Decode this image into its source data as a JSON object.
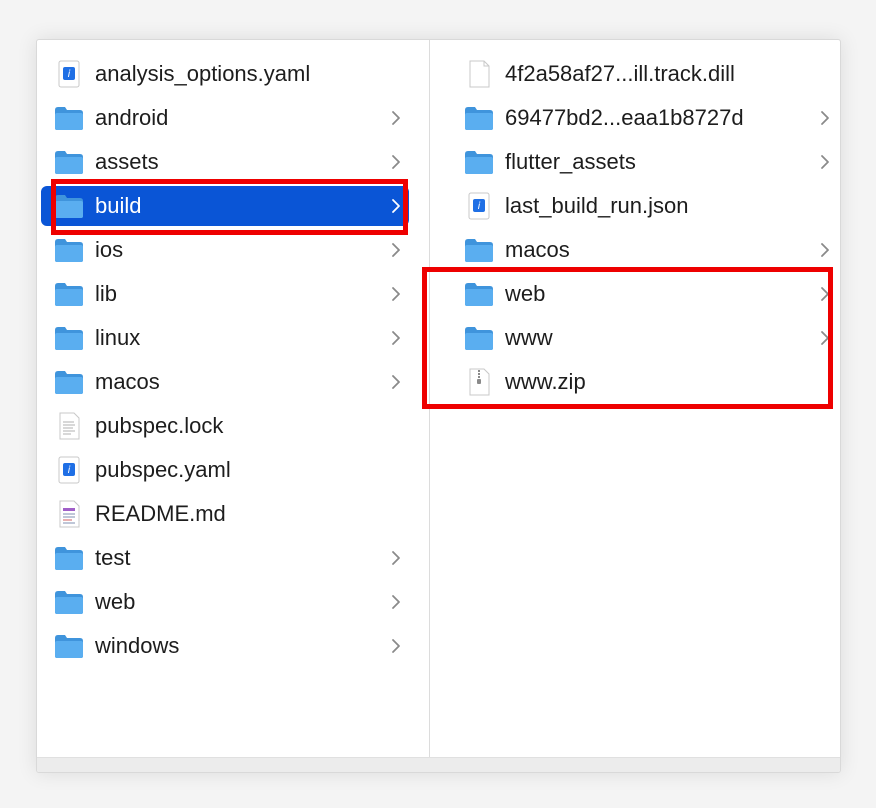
{
  "left_column": {
    "items": [
      {
        "label": "analysis_options.yaml",
        "kind": "yaml",
        "chevron": false
      },
      {
        "label": "android",
        "kind": "folder",
        "chevron": true
      },
      {
        "label": "assets",
        "kind": "folder",
        "chevron": true
      },
      {
        "label": "build",
        "kind": "folder",
        "chevron": true,
        "selected": true
      },
      {
        "label": "ios",
        "kind": "folder",
        "chevron": true
      },
      {
        "label": "lib",
        "kind": "folder",
        "chevron": true
      },
      {
        "label": "linux",
        "kind": "folder",
        "chevron": true
      },
      {
        "label": "macos",
        "kind": "folder",
        "chevron": true
      },
      {
        "label": "pubspec.lock",
        "kind": "text-doc",
        "chevron": false
      },
      {
        "label": "pubspec.yaml",
        "kind": "yaml",
        "chevron": false
      },
      {
        "label": "README.md",
        "kind": "markdown",
        "chevron": false
      },
      {
        "label": "test",
        "kind": "folder",
        "chevron": true
      },
      {
        "label": "web",
        "kind": "folder",
        "chevron": true
      },
      {
        "label": "windows",
        "kind": "folder",
        "chevron": true
      }
    ]
  },
  "right_column": {
    "items": [
      {
        "label": "4f2a58af27...ill.track.dill",
        "kind": "blank-doc",
        "chevron": false
      },
      {
        "label": "69477bd2...eaa1b8727d",
        "kind": "folder",
        "chevron": true
      },
      {
        "label": "flutter_assets",
        "kind": "folder",
        "chevron": true
      },
      {
        "label": "last_build_run.json",
        "kind": "yaml",
        "chevron": false
      },
      {
        "label": "macos",
        "kind": "folder",
        "chevron": true
      },
      {
        "label": "web",
        "kind": "folder",
        "chevron": true
      },
      {
        "label": "www",
        "kind": "folder",
        "chevron": true
      },
      {
        "label": "www.zip",
        "kind": "zip",
        "chevron": false
      }
    ]
  },
  "colors": {
    "selection": "#0a55d6",
    "annotation": "#ee0000",
    "folder": "#5aaef0"
  }
}
